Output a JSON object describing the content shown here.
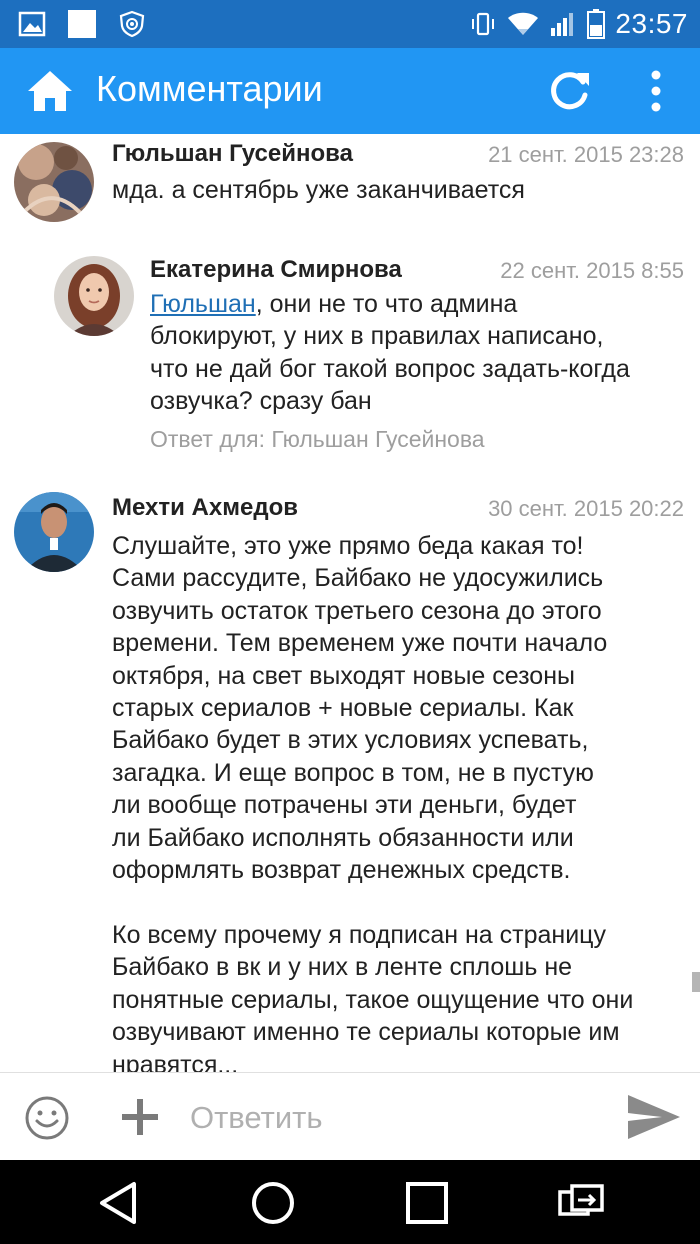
{
  "status_bar": {
    "time": "23:57"
  },
  "app_bar": {
    "title": "Комментарии"
  },
  "comments": [
    {
      "author": "Гюльшан Гусейнова",
      "time": "21 сент. 2015 23:28",
      "text": "мда. а сентябрь уже заканчивается"
    },
    {
      "author": "Екатерина Смирнова",
      "time": "22 сент. 2015 8:55",
      "mention": "Гюльшан",
      "text": ", они не то что админа\nблокируют, у них в правилах написано,\nчто не дай бог такой вопрос задать-когда\nозвучка? сразу бан",
      "reply_to": "Ответ для: Гюльшан Гусейнова"
    },
    {
      "author": "Мехти Ахмедов",
      "time": "30 сент. 2015 20:22",
      "text": "Слушайте, это уже прямо беда какая то!\nСами рассудите, Байбако не удосужились\nозвучить остаток третьего сезона до этого\nвремени. Тем временем уже почти начало\nоктября, на свет выходят новые сезоны\nстарых сериалов + новые сериалы. Как\nБайбако будет в этих условиях успевать,\nзагадка. И еще вопрос в том, не в пустую\nли вообще потрачены эти деньги, будет\nли Байбако исполнять обязанности или\nоформлять возврат денежных средств.\n\nКо всему прочему я подписан на страницу\nБайбако в вк и у них в ленте сплошь не\nпонятные сериалы, такое ощущение что они\nозвучивают именно те сериалы которые им\nнравятся..."
    }
  ],
  "reply_bar": {
    "placeholder": "Ответить"
  },
  "colors": {
    "status_bar": "#1d6fbf",
    "app_bar": "#2196f3",
    "mention": "#1f6fb5",
    "muted": "#9e9e9e"
  },
  "icons": {
    "status_left": [
      "gallery-icon",
      "blank-notification-icon",
      "shield-lion-icon"
    ],
    "status_right": [
      "vibrate-icon",
      "wifi-icon",
      "signal-icon",
      "battery-icon"
    ],
    "app_bar": [
      "home-icon",
      "refresh-icon",
      "more-vert-icon"
    ],
    "reply_bar": [
      "emoji-icon",
      "plus-icon",
      "send-icon"
    ],
    "nav": [
      "back-icon",
      "home-circle-icon",
      "recents-icon",
      "switch-apps-icon"
    ]
  }
}
